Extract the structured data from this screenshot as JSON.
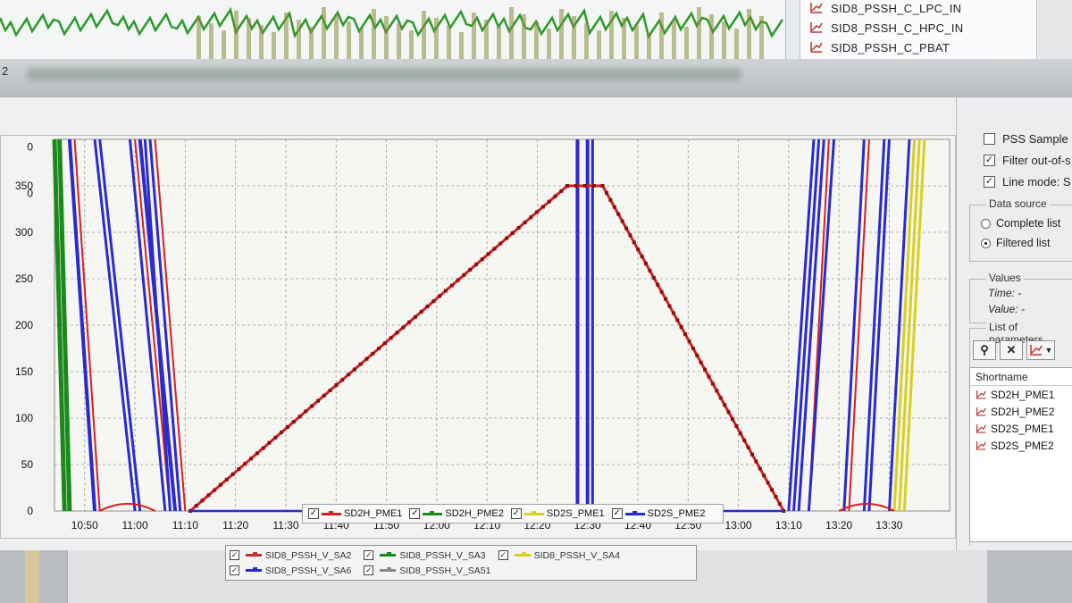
{
  "background_window": {
    "legend_items": [
      {
        "label": "SID8_PSSH_C_LPC_IN",
        "color": "#c03030"
      },
      {
        "label": "SID8_PSSH_C_HPC_IN",
        "color": "#c03030"
      },
      {
        "label": "SID8_PSSH_C_PBAT",
        "color": "#c03030"
      }
    ],
    "window_marker": "2"
  },
  "right_panel": {
    "options": [
      {
        "label": "PSS Sample",
        "checked": false
      },
      {
        "label": "Filter out-of-s",
        "checked": true
      },
      {
        "label": "Line mode: S",
        "checked": true
      }
    ],
    "data_source": {
      "title": "Data source",
      "choices": [
        {
          "label": "Complete list",
          "selected": false
        },
        {
          "label": "Filtered list",
          "selected": true
        }
      ]
    },
    "values": {
      "title": "Values",
      "time_label": "Time:",
      "time_value": "-",
      "value_label": "Value:",
      "value_value": "-"
    },
    "parameters": {
      "title": "List of parameters",
      "toolbar": [
        "pin-icon",
        "close-icon",
        "chart-icon",
        "dropdown-icon"
      ],
      "column_header": "Shortname",
      "items": [
        "SD2H_PME1",
        "SD2H_PME2",
        "SD2S_PME1",
        "SD2S_PME2"
      ]
    }
  },
  "chart_legend": [
    {
      "label": "SD2H_PME1",
      "color": "#d42020",
      "checked": true
    },
    {
      "label": "SD2H_PME2",
      "color": "#1a8a1a",
      "checked": true
    },
    {
      "label": "SD2S_PME1",
      "color": "#d8d020",
      "checked": true
    },
    {
      "label": "SD2S_PME2",
      "color": "#2a2ad0",
      "checked": true
    }
  ],
  "bottom_legend": {
    "row1": [
      {
        "label": "SID8_PSSH_V_SA2",
        "color": "#c03030"
      },
      {
        "label": "SID8_PSSH_V_SA3",
        "color": "#1a8a1a"
      },
      {
        "label": "SID8_PSSH_V_SA4",
        "color": "#d8d020"
      }
    ],
    "row2": [
      {
        "label": "SID8_PSSH_V_SA6",
        "color": "#2a2ad0"
      },
      {
        "label": "SID8_PSSH_V_SA51",
        "color": "#888888"
      }
    ]
  },
  "chart_data": {
    "type": "line",
    "title": "",
    "xlabel": "",
    "ylabel": "",
    "y_ticks": [
      "0",
      "50",
      "100",
      "150",
      "200",
      "250",
      "300",
      "350",
      "0",
      "0"
    ],
    "x_ticks": [
      "10:50",
      "11:00",
      "11:10",
      "11:20",
      "11:30",
      "11:40",
      "11:50",
      "12:00",
      "12:10",
      "12:20",
      "12:30",
      "12:40",
      "12:50",
      "13:00",
      "13:10",
      "13:20",
      "13:30"
    ],
    "ylim": [
      0,
      400
    ],
    "grid": true,
    "series": [
      {
        "name": "SD2H_PME1",
        "color": "#d42020",
        "points": [
          [
            "11:11",
            0
          ],
          [
            "12:26",
            350
          ],
          [
            "12:33",
            350
          ],
          [
            "13:09",
            0
          ]
        ]
      },
      {
        "name": "SD2S_PME2",
        "color": "#2a2ad0",
        "points": [
          [
            "11:11",
            0
          ],
          [
            "12:28",
            0
          ],
          [
            "13:09",
            0
          ]
        ]
      }
    ]
  }
}
